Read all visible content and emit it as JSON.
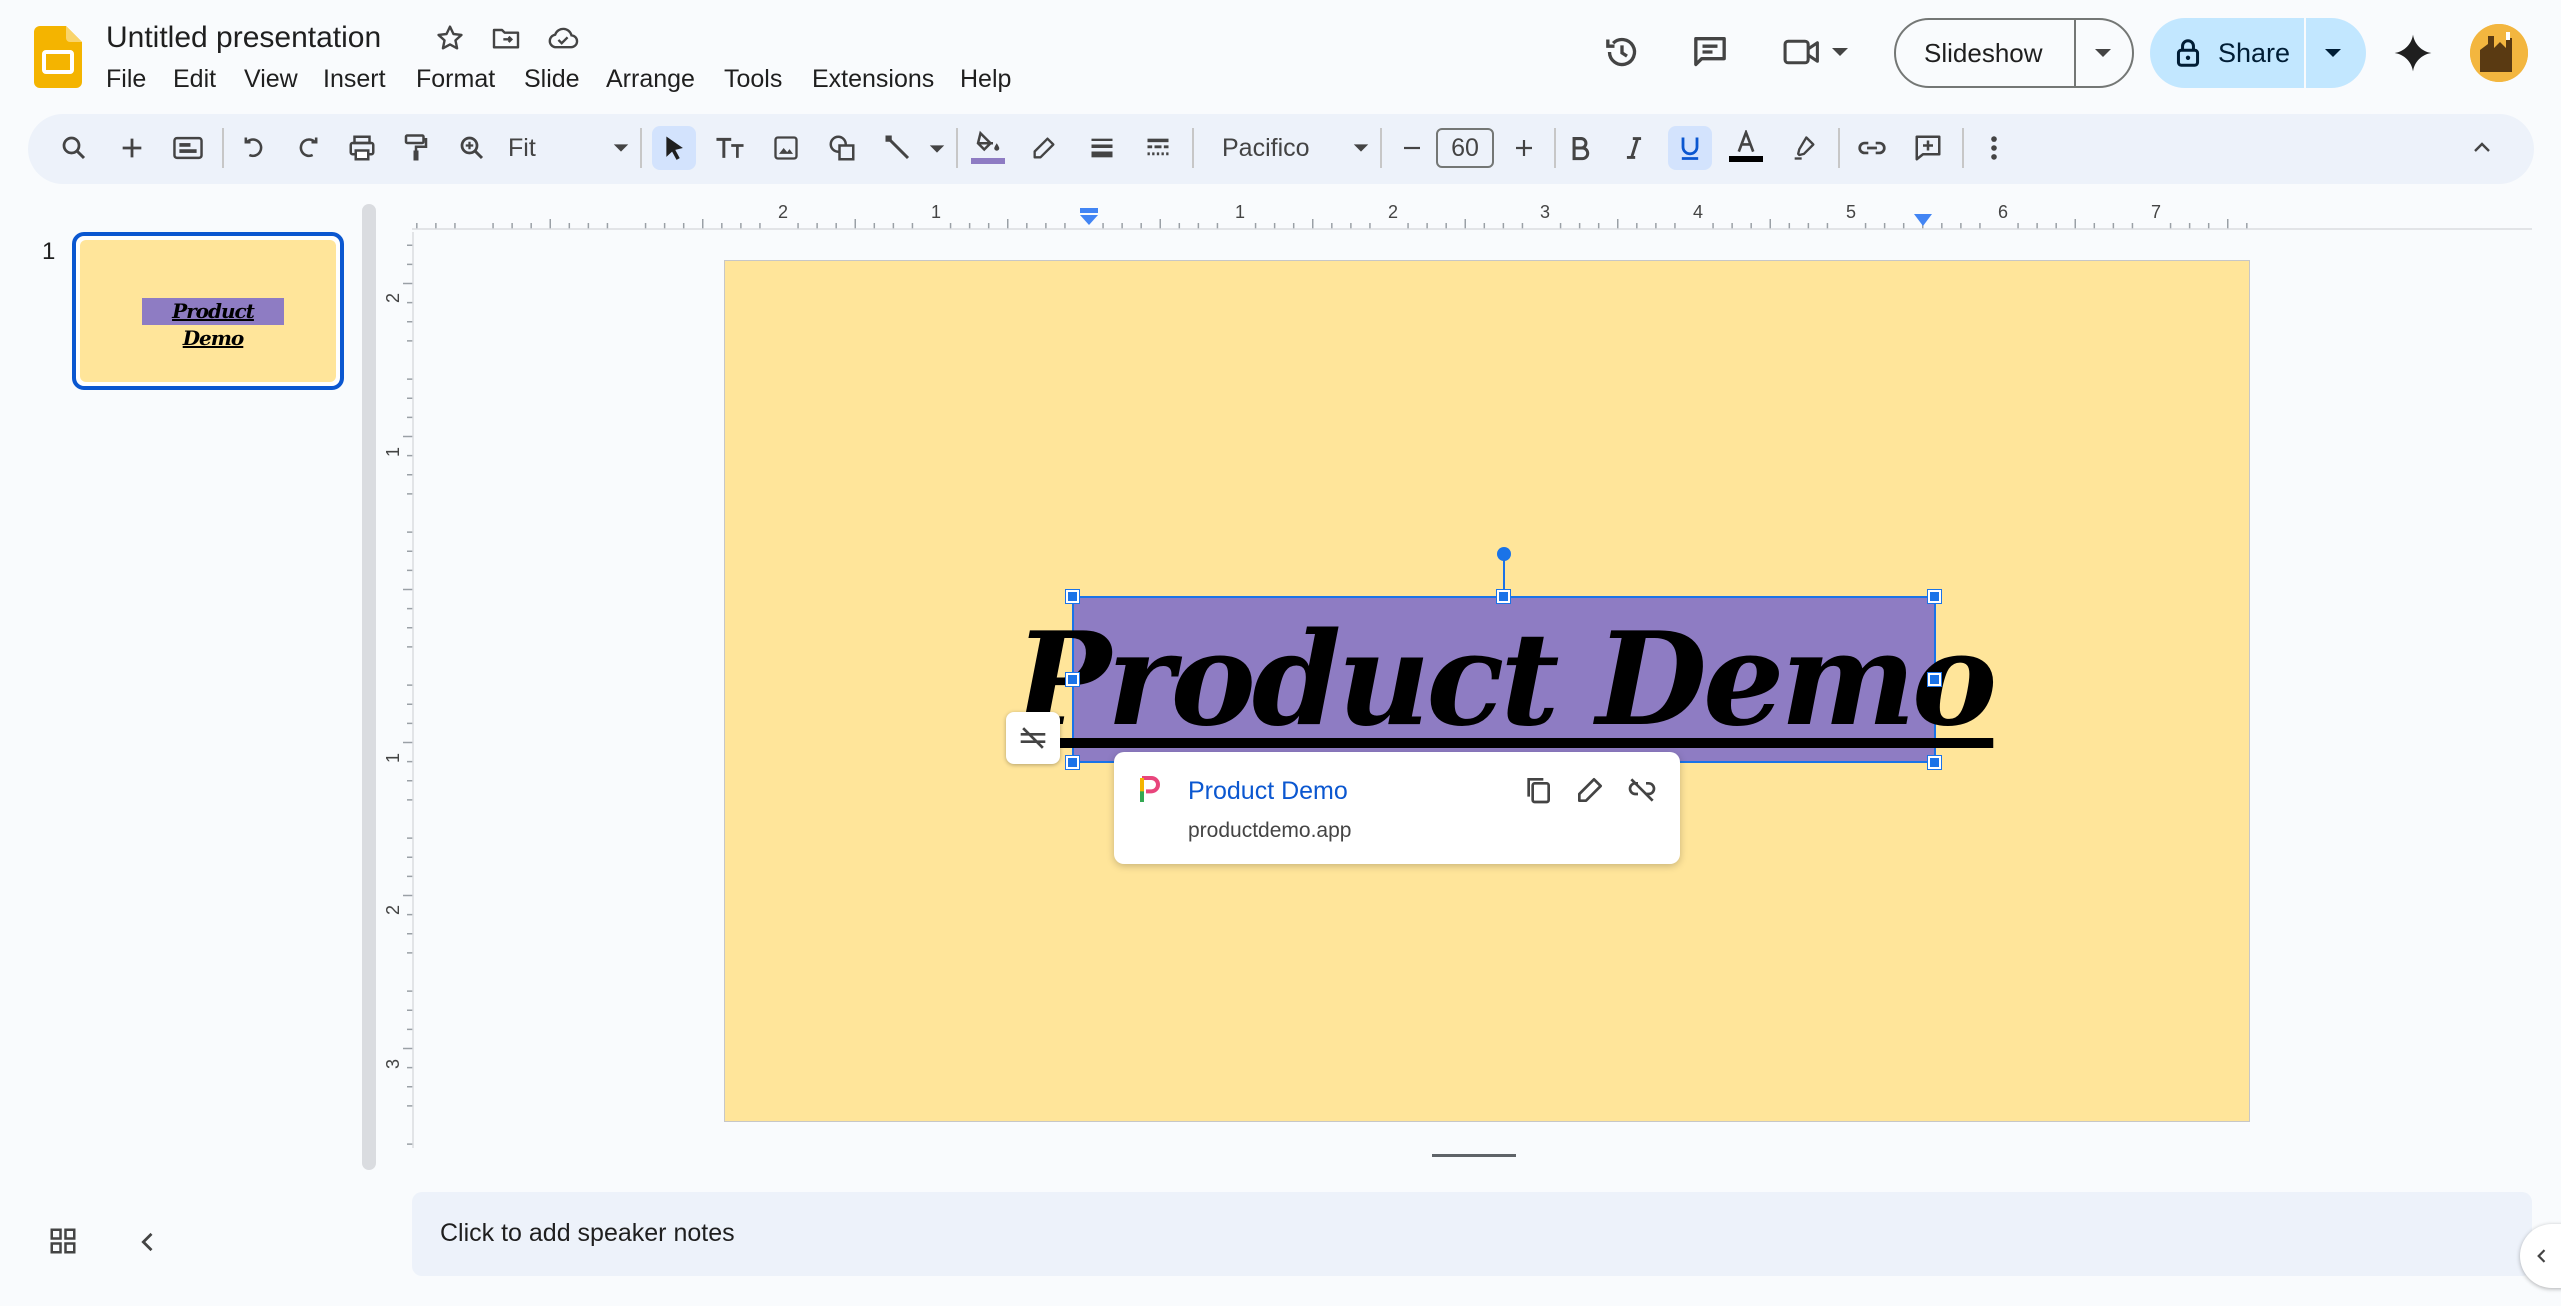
{
  "app": {
    "doc_title": "Untitled presentation",
    "menu": [
      "File",
      "Edit",
      "View",
      "Insert",
      "Format",
      "Slide",
      "Arrange",
      "Tools",
      "Extensions",
      "Help"
    ]
  },
  "header": {
    "slideshow_label": "Slideshow",
    "share_label": "Share"
  },
  "toolbar": {
    "zoom_value": "Fit",
    "font_name": "Pacifico",
    "font_size": "60"
  },
  "ruler": {
    "horizontal": [
      "2",
      "1",
      "1",
      "2",
      "3",
      "4",
      "5",
      "6",
      "7"
    ],
    "vertical": [
      "2",
      "1",
      "1",
      "2",
      "3"
    ]
  },
  "filmstrip": {
    "slide_number": "1",
    "thumb_text": "Product Demo"
  },
  "slide": {
    "title_text": "Product Demo",
    "background": "#ffe59a",
    "textbox_fill": "#8e7cc3"
  },
  "link_popup": {
    "title": "Product Demo",
    "url": "productdemo.app"
  },
  "notes": {
    "placeholder": "Click to add speaker notes"
  },
  "colors": {
    "accent": "#1a73e8",
    "share_bg": "#c2e7ff",
    "toolbar_bg": "#edf2fa"
  }
}
